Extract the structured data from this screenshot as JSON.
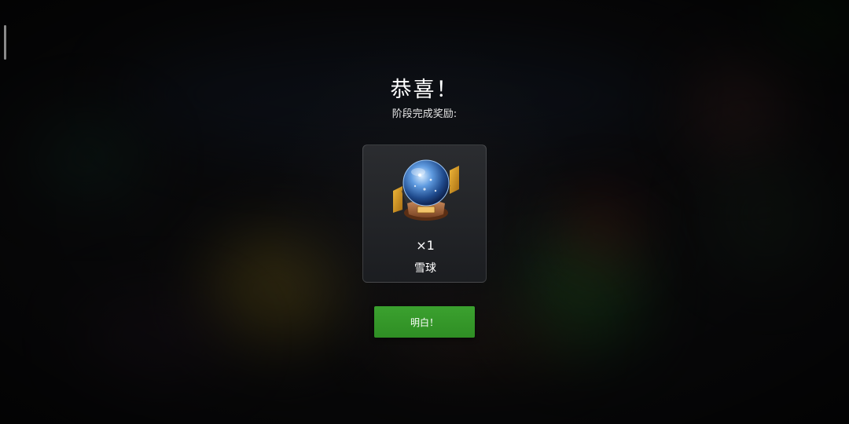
{
  "dialog": {
    "title": "恭喜！",
    "subtitle": "阶段完成奖励:"
  },
  "reward": {
    "quantity": "×1",
    "name": "雪球",
    "icon": "snow-globe-icon"
  },
  "buttons": {
    "confirm_label": "明白！"
  },
  "colors": {
    "accent_green": "#3ba12f",
    "card_bg": "#2a2c30",
    "text": "#ffffff"
  }
}
